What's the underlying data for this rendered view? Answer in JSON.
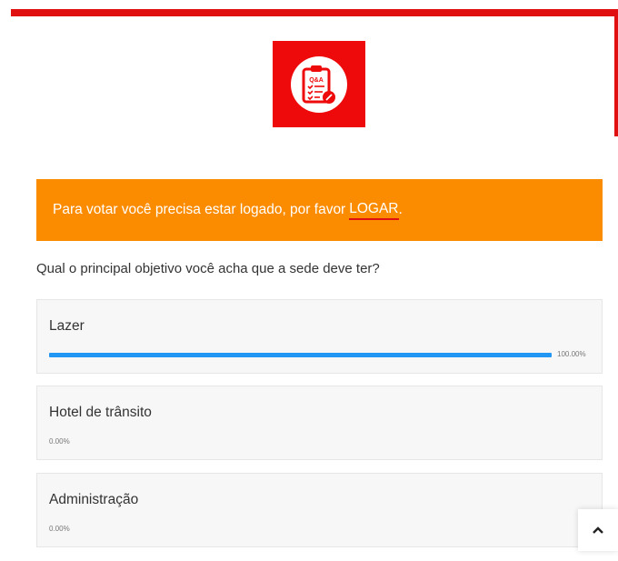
{
  "brand": {
    "logo_text": "Q&A",
    "accent_color": "#ee0a0a",
    "logo_icon": "clipboard-checklist-icon"
  },
  "alert": {
    "message": "Para votar você precisa estar logado, por favor",
    "login_label": "LOGAR",
    "trailing": ".",
    "color": "#fb8c00"
  },
  "poll": {
    "question": "Qual o principal objetivo você acha que a sede deve ter?",
    "bar_color": "#2196f3",
    "options": [
      {
        "label": "Lazer",
        "percent_text": "100.00%",
        "percent": 100
      },
      {
        "label": "Hotel de trânsito",
        "percent_text": "0.00%",
        "percent": 0
      },
      {
        "label": "Administração",
        "percent_text": "0.00%",
        "percent": 0
      }
    ]
  },
  "scroll_top": {
    "icon": "chevron-up-icon"
  }
}
